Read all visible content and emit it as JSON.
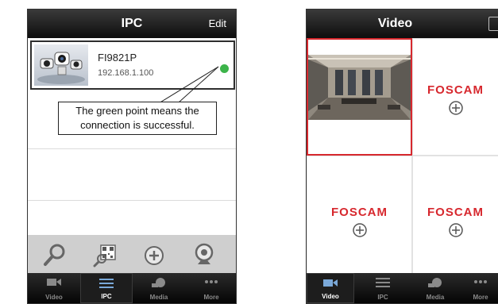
{
  "ipc_screen": {
    "title": "IPC",
    "edit_label": "Edit",
    "device": {
      "name": "FI9821P",
      "ip": "192.168.1.100",
      "status_color": "#3cb44a"
    },
    "callout_text": "The green point means the connection is successful.",
    "toolbar_icons": [
      "search-icon",
      "qr-scan-icon",
      "add-circle-icon",
      "webcam-icon"
    ],
    "tabs": [
      {
        "label": "Video",
        "icon": "camcorder-icon",
        "active": false
      },
      {
        "label": "IPC",
        "icon": "list-icon",
        "active": true
      },
      {
        "label": "Media",
        "icon": "film-reel-icon",
        "active": false
      },
      {
        "label": "More",
        "icon": "more-dots-icon",
        "active": false
      }
    ]
  },
  "video_screen": {
    "title": "Video",
    "cells": [
      {
        "type": "live-view",
        "selected": true
      },
      {
        "type": "empty",
        "logo": "FOSCAM",
        "selected": false
      },
      {
        "type": "empty",
        "logo": "FOSCAM",
        "selected": false
      },
      {
        "type": "empty",
        "logo": "FOSCAM",
        "selected": false
      }
    ],
    "tabs": [
      {
        "label": "Video",
        "icon": "camcorder-icon",
        "active": true
      },
      {
        "label": "IPC",
        "icon": "list-icon",
        "active": false
      },
      {
        "label": "Media",
        "icon": "film-reel-icon",
        "active": false
      },
      {
        "label": "More",
        "icon": "more-dots-icon",
        "active": false
      }
    ]
  },
  "colors": {
    "accent_red": "#d7282e",
    "status_green": "#3cb44a",
    "bar_dark": "#0d0d0d"
  }
}
